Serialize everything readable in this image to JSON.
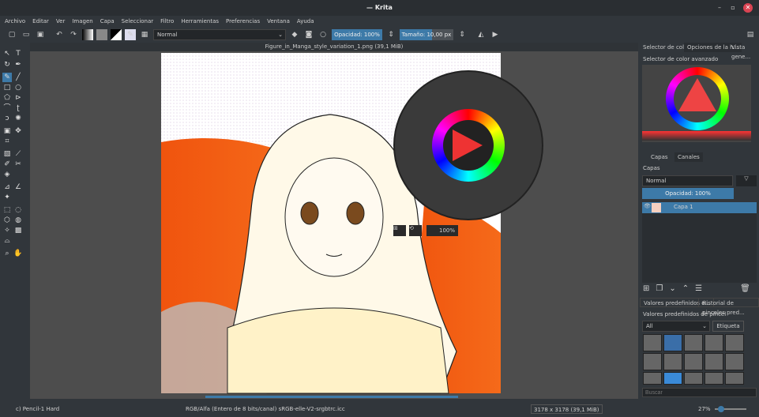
{
  "window": {
    "title": "— Krita",
    "minimize": "–",
    "maximize": "▫",
    "close": "✕"
  },
  "menu": [
    "Archivo",
    "Editar",
    "Ver",
    "Imagen",
    "Capa",
    "Seleccionar",
    "Filtro",
    "Herramientas",
    "Preferencias",
    "Ventana",
    "Ayuda"
  ],
  "toolbar": {
    "blend_mode": "Normal",
    "opacity": "Opacidad: 100%",
    "size": "Tamaño: 10,00 px"
  },
  "document": {
    "title": "Figure_in_Manga_style_variation_1.png (39,1 MiB)"
  },
  "popup": {
    "zoom": "100%"
  },
  "right_panel": {
    "top_tabs": [
      "Selector de colo...",
      "Opciones de la h...",
      "Vista gene..."
    ],
    "color_selector_title": "Selector de color avanzado",
    "layer_tabs": [
      "Capas",
      "Canales"
    ],
    "layers_title": "Capas",
    "layer_blend": "Normal",
    "layer_opacity": "Opacidad:  100%",
    "layers": [
      {
        "name": "Capa 1"
      }
    ],
    "bottom_tabs": [
      "Valores predefinidos d...",
      "Historial de pinceles pred..."
    ],
    "presets_title": "Valores predefinidos de pincel",
    "presets_filter": "All",
    "tag_button": "Etiqueta",
    "search_placeholder": "Buscar"
  },
  "status": {
    "brush": "c) Pencil-1 Hard",
    "color_space": "RGB/Alfa (Entero de 8 bits/canal)  sRGB-elle-V2-srgbtrc.icc",
    "dimensions": "3178 x 3178 (39,1 MiB)",
    "zoom": "27%"
  },
  "colors": {
    "accent": "#3d7aa8",
    "bg": "#31363b",
    "orange": "#f25a12"
  }
}
